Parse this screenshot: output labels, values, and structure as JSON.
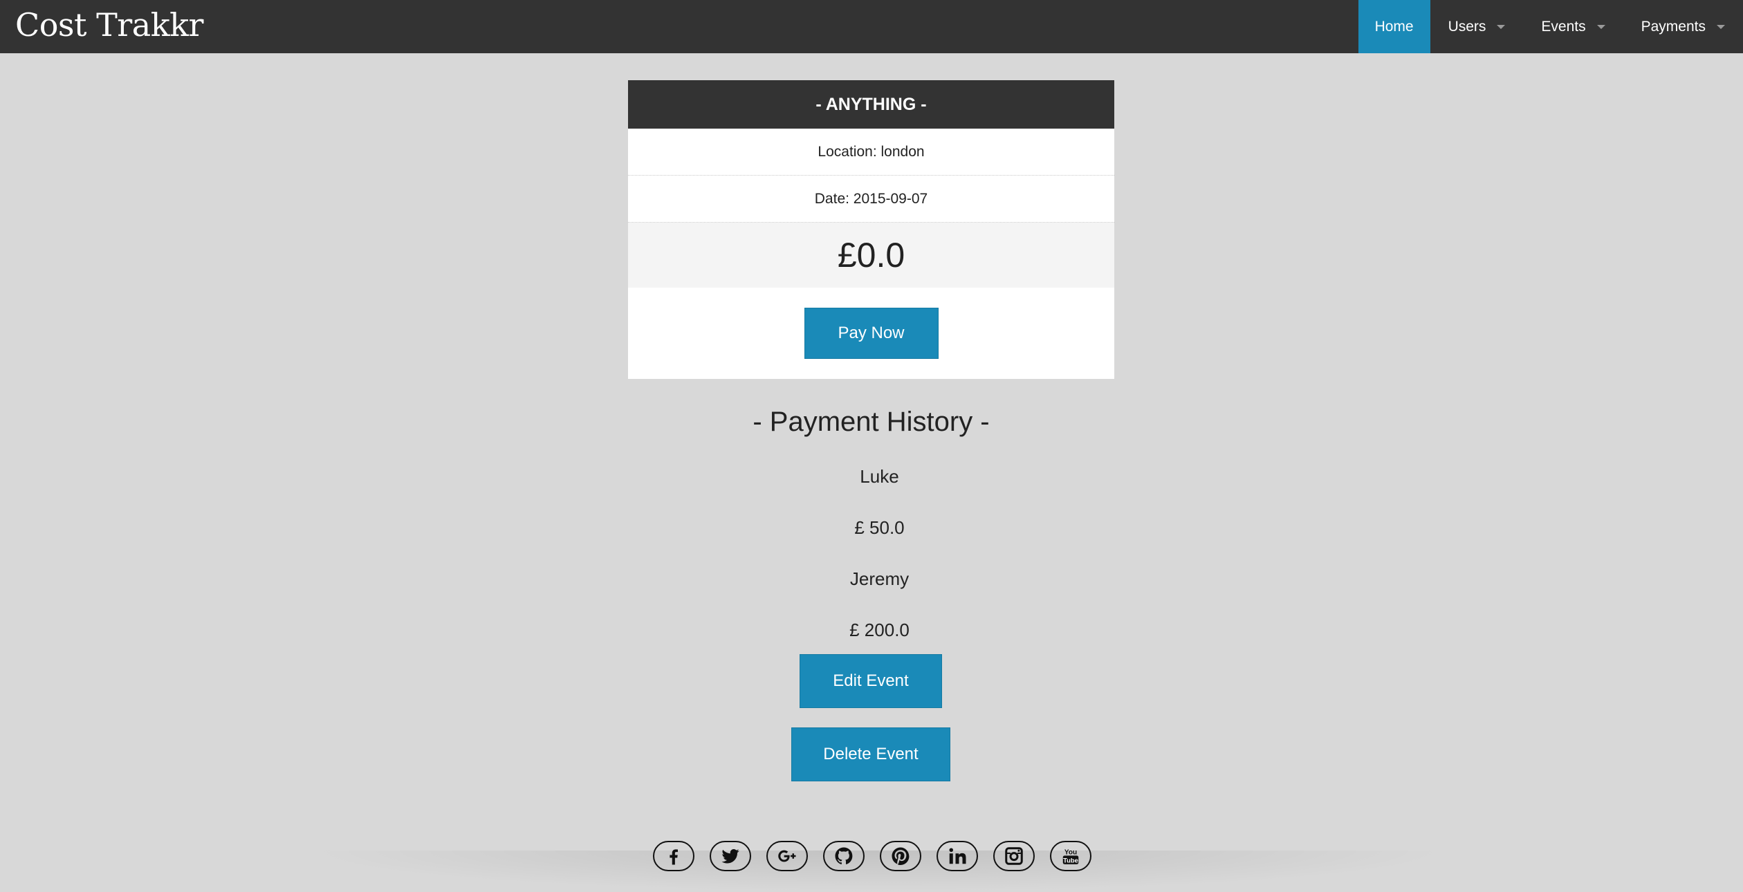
{
  "app": {
    "brand": "Cost Trakkr"
  },
  "nav": {
    "items": [
      {
        "label": "Home"
      },
      {
        "label": "Users"
      },
      {
        "label": "Events"
      },
      {
        "label": "Payments"
      }
    ]
  },
  "event": {
    "title": "- ANYTHING -",
    "location": "Location: london",
    "date": "Date: 2015-09-07",
    "amount": "£0.0",
    "pay_label": "Pay Now"
  },
  "history": {
    "title": "- Payment History -",
    "entries": [
      {
        "name": "Luke",
        "amount": "£ 50.0"
      },
      {
        "name": "Jeremy",
        "amount": "£ 200.0"
      }
    ]
  },
  "actions": {
    "edit_label": "Edit Event",
    "delete_label": "Delete Event"
  },
  "footer": {
    "social": [
      "facebook-icon",
      "twitter-icon",
      "google-plus-icon",
      "github-icon",
      "pinterest-icon",
      "linkedin-icon",
      "instagram-icon",
      "youtube-icon"
    ]
  },
  "colors": {
    "topbar": "#333333",
    "accent": "#1a8ab8",
    "page_bg": "#d8d8d8"
  }
}
